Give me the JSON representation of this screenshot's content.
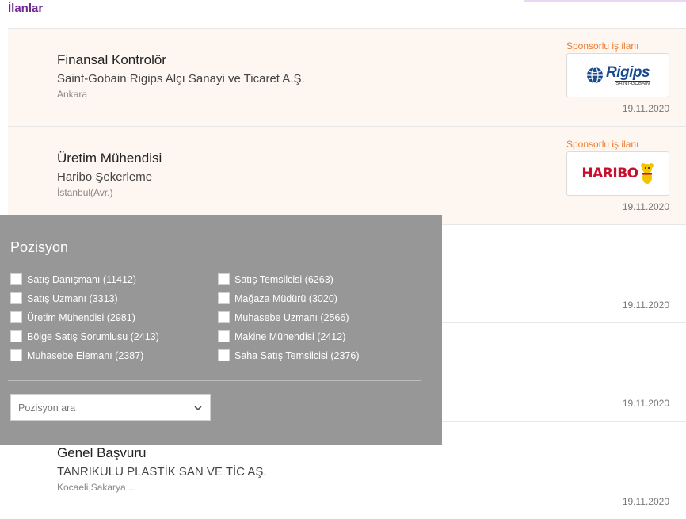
{
  "section_title": "İlanlar",
  "listings": [
    {
      "title": "Finansal Kontrolör",
      "company": "Saint-Gobain Rigips Alçı Sanayi ve Ticaret A.Ş.",
      "location": "Ankara",
      "date": "19.11.2020",
      "sponsored": true,
      "sponsor_label": "Sponsorlu iş ilanı",
      "logo": {
        "word": "Rigips",
        "sub": "SAINT-GOBAIN",
        "color": "#1a4a8e"
      }
    },
    {
      "title": "Üretim Mühendisi",
      "company": "Haribo Şekerleme",
      "location": "İstanbul(Avr.)",
      "date": "19.11.2020",
      "sponsored": true,
      "sponsor_label": "Sponsorlu iş ilanı",
      "logo": {
        "word": "HARIBO",
        "color": "#c8102e"
      }
    },
    {
      "title": "",
      "company": "",
      "location": "",
      "date": "19.11.2020",
      "sponsored": false
    },
    {
      "title": "",
      "company": "",
      "location": "",
      "date": "19.11.2020",
      "sponsored": false
    },
    {
      "title": "Genel Başvuru",
      "company": "TANRIKULU PLASTİK SAN VE TİC AŞ.",
      "location": "Kocaeli,Sakarya ...",
      "date": "19.11.2020",
      "sponsored": false
    }
  ],
  "filter": {
    "title": "Pozisyon",
    "options_left": [
      "Satış Danışmanı (11412)",
      "Satış Uzmanı (3313)",
      "Üretim Mühendisi (2981)",
      "Bölge Satış Sorumlusu (2413)",
      "Muhasebe Elemanı (2387)"
    ],
    "options_right": [
      "Satış Temsilcisi (6263)",
      "Mağaza Müdürü (3020)",
      "Muhasebe Uzmanı (2566)",
      "Makine Mühendisi (2412)",
      "Saha Satış Temsilcisi (2376)"
    ],
    "search_placeholder": "Pozisyon ara"
  },
  "colors": {
    "accent": "#6f2b8e",
    "sponsor": "#f07c2b",
    "sponsored_bg": "#fdf6f1",
    "filter_bg": "#979797"
  },
  "icons": {
    "dropdown": "chevron-down-icon",
    "checkbox": "checkbox-icon"
  }
}
